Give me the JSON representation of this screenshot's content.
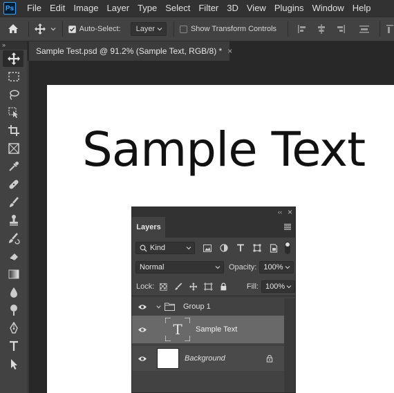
{
  "app": {
    "logo": "Ps"
  },
  "menu": [
    "File",
    "Edit",
    "Image",
    "Layer",
    "Type",
    "Select",
    "Filter",
    "3D",
    "View",
    "Plugins",
    "Window",
    "Help"
  ],
  "options": {
    "auto_select_label": "Auto-Select:",
    "auto_select_value": "Layer",
    "show_transform_label": "Show Transform Controls"
  },
  "document": {
    "tab_title": "Sample Test.psd @ 91.2% (Sample Text, RGB/8) *",
    "close_symbol": "×",
    "text_content": "Sample Text"
  },
  "toolbar": {
    "collapse": "»",
    "tools": [
      "move-tool-icon",
      "marquee-tool-icon",
      "lasso-tool-icon",
      "object-select-tool-icon",
      "crop-tool-icon",
      "frame-tool-icon",
      "eyedropper-tool-icon",
      "healing-brush-icon",
      "brush-tool-icon",
      "clone-stamp-icon",
      "history-brush-icon",
      "eraser-tool-icon",
      "gradient-tool-icon",
      "blur-tool-icon",
      "dodge-tool-icon",
      "pen-tool-icon",
      "type-tool-icon",
      "path-select-tool-icon"
    ]
  },
  "layers_panel": {
    "header_collapse": "‹‹",
    "header_close": "×",
    "tab_label": "Layers",
    "filter_kind": "Kind",
    "blend_mode": "Normal",
    "opacity_label": "Opacity:",
    "opacity_value": "100%",
    "lock_label": "Lock:",
    "fill_label": "Fill:",
    "fill_value": "100%",
    "layers": [
      {
        "name": "Group 1",
        "type": "group"
      },
      {
        "name": "Sample Text",
        "type": "text",
        "thumb_glyph": "T",
        "selected": true
      },
      {
        "name": "Background",
        "type": "background",
        "locked": true
      }
    ]
  },
  "colors": {
    "accent": "#31a8ff",
    "menubar": "#323232",
    "panel": "#424242",
    "selected_layer": "#696969"
  }
}
